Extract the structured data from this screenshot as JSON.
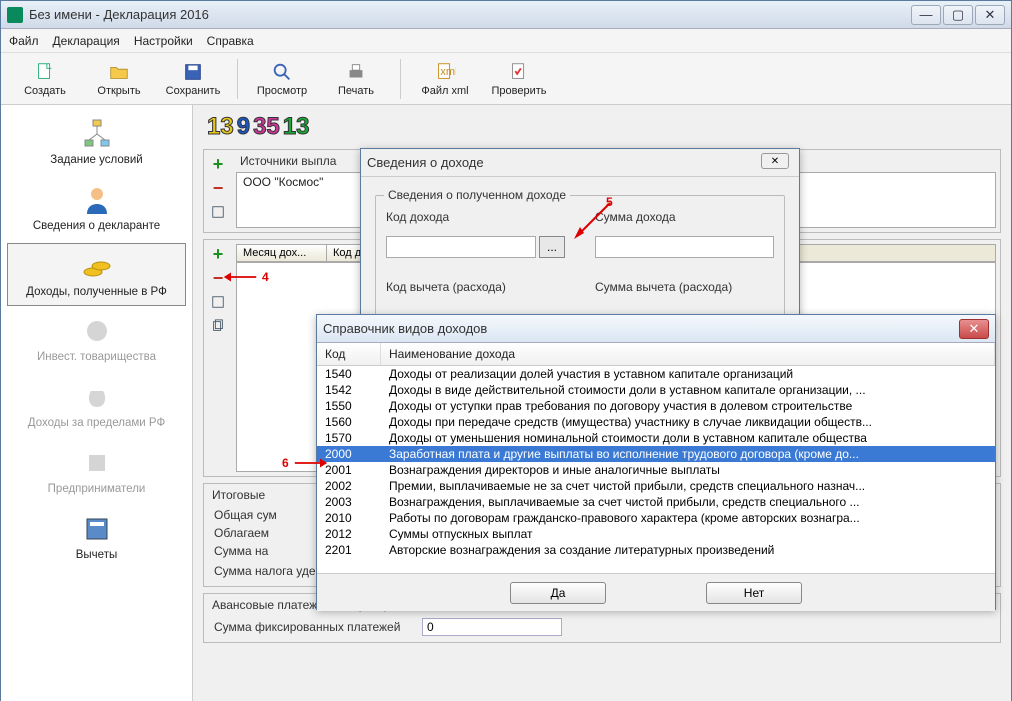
{
  "app": {
    "title": "Без имени - Декларация 2016"
  },
  "menu": {
    "file": "Файл",
    "decl": "Декларация",
    "settings": "Настройки",
    "help": "Справка"
  },
  "toolbar": {
    "create": "Создать",
    "open": "Открыть",
    "save": "Сохранить",
    "preview": "Просмотр",
    "print": "Печать",
    "xml": "Файл xml",
    "check": "Проверить"
  },
  "sidebar": {
    "cond": "Задание условий",
    "declarant": "Сведения о декларанте",
    "income_rf": "Доходы, полученные в РФ",
    "invest": "Инвест. товарищества",
    "income_foreign": "Доходы за пределами РФ",
    "biz": "Предприниматели",
    "deduct": "Вычеты"
  },
  "numbers": [
    "13",
    "9",
    "35",
    "13"
  ],
  "number_colors": [
    "#e6c618",
    "#1858c8",
    "#d0369a",
    "#19a837"
  ],
  "sources": {
    "header": "Источники выпла",
    "item1": "ООО \"Космос\""
  },
  "grid": {
    "month": "Месяц дох...",
    "code": "Код д"
  },
  "totals": {
    "header": "Итоговые",
    "row1": "Общая сум",
    "row2": "Облагаем",
    "row3": "Сумма на",
    "row4": "Сумма налога удержанная"
  },
  "advance": {
    "header": "Авансовые платежи иностранца",
    "row": "Сумма фиксированных платежей"
  },
  "dlg1": {
    "title": "Сведения о доходе",
    "group": "Сведения о полученном доходе",
    "code_label": "Код дохода",
    "sum_label": "Сумма дохода",
    "deduct_code": "Код вычета (расхода)",
    "deduct_sum": "Сумма вычета (расхода)"
  },
  "dlg2": {
    "title": "Справочник видов доходов",
    "col1": "Код",
    "col2": "Наименование дохода",
    "rows": [
      {
        "code": "1540",
        "name": "Доходы от реализации долей участия в уставном капитале организаций"
      },
      {
        "code": "1542",
        "name": "Доходы в виде действительной стоимости доли в уставном капитале организации, ..."
      },
      {
        "code": "1550",
        "name": "Доходы от уступки прав требования по договору участия в долевом строительстве"
      },
      {
        "code": "1560",
        "name": "Доходы при передаче средств (имущества) участнику в случае ликвидации обществ..."
      },
      {
        "code": "1570",
        "name": "Доходы от уменьшения номинальной стоимости доли в уставном капитале общества"
      },
      {
        "code": "2000",
        "name": "Заработная плата и другие выплаты во исполнение трудового договора (кроме до...",
        "selected": true
      },
      {
        "code": "2001",
        "name": "Вознаграждения директоров и иные аналогичные выплаты"
      },
      {
        "code": "2002",
        "name": "Премии, выплачиваемые не за счет чистой прибыли, средств специального назнач..."
      },
      {
        "code": "2003",
        "name": "Вознаграждения, выплачиваемые за счет чистой прибыли, средств специального ..."
      },
      {
        "code": "2010",
        "name": "Работы по договорам гражданско-правового характера (кроме авторских вознагра..."
      },
      {
        "code": "2012",
        "name": "Суммы отпускных выплат"
      },
      {
        "code": "2201",
        "name": "Авторские вознаграждения за создание литературных произведений"
      }
    ],
    "yes": "Да",
    "no": "Нет"
  },
  "annotations": {
    "a4": "4",
    "a5": "5",
    "a6": "6"
  }
}
